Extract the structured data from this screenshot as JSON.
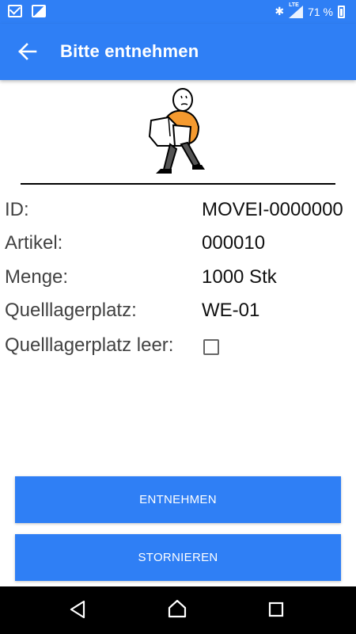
{
  "status_bar": {
    "left_icons": [
      "gmail-icon",
      "gallery-icon"
    ],
    "right_icons": [
      "bluetooth-icon",
      "lte-signal-icon",
      "battery-icon"
    ],
    "network_label": "LTE",
    "battery_text": "71 %"
  },
  "app_bar": {
    "back_icon": "arrow-left-icon",
    "title": "Bitte entnehmen"
  },
  "illustration": {
    "icon": "person-carrying-box-icon"
  },
  "details": {
    "id_label": "ID:",
    "id_value": "MOVEI-0000000",
    "artikel_label": "Artikel:",
    "artikel_value": "000010",
    "menge_label": "Menge:",
    "menge_value": "1000 Stk",
    "quelllagerplatz_label": "Quelllagerplatz:",
    "quelllagerplatz_value": "WE-01",
    "leer_label": "Quelllagerplatz leer:",
    "leer_checked": false
  },
  "actions": {
    "entnehmen_label": "ENTNEHMEN",
    "stornieren_label": "STORNIEREN"
  },
  "nav_bar": {
    "icons": [
      "back-triangle-icon",
      "home-icon",
      "recent-apps-icon"
    ]
  },
  "colors": {
    "primary": "#2f7ff5",
    "label_text": "#424242",
    "value_text": "#111111",
    "illustration_orange": "#f59a2f"
  }
}
